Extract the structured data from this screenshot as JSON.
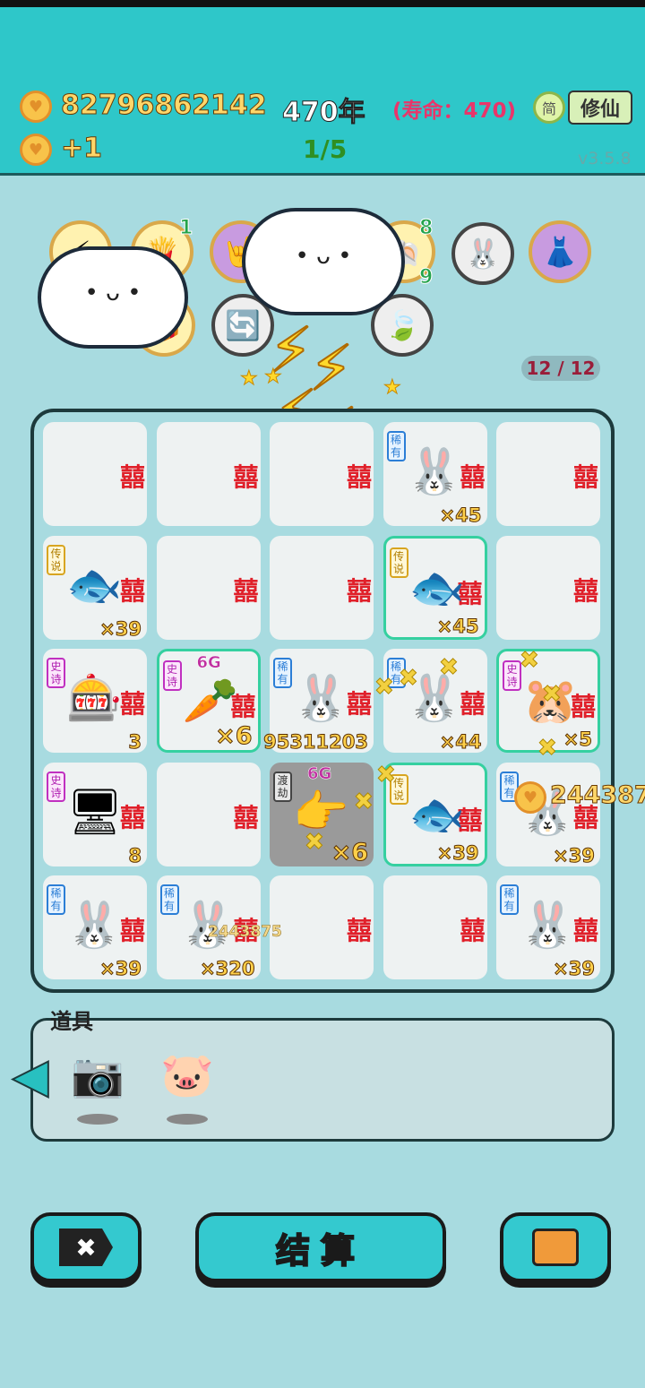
{
  "hud": {
    "coins": "82796862142",
    "income": "+1",
    "years": "470年",
    "lifespan": "(寿命：470)",
    "progress": "1/5",
    "lang_button": "简",
    "cultivate_button": "修仙",
    "version": "v3.5.8"
  },
  "relics": {
    "count_fries": "1",
    "count_shell": "8",
    "count_leaf": "9"
  },
  "board": {
    "counter": "12 / 12",
    "cells": [
      {
        "rarity": "",
        "icon": "empty",
        "mult": ""
      },
      {
        "rarity": "",
        "icon": "empty",
        "mult": ""
      },
      {
        "rarity": "",
        "icon": "empty",
        "mult": ""
      },
      {
        "rarity": "稀有",
        "icon": "rabbit",
        "mult": "×45"
      },
      {
        "rarity": "",
        "icon": "empty",
        "mult": ""
      },
      {
        "rarity": "传说",
        "icon": "koi-fish",
        "mult": "×39"
      },
      {
        "rarity": "",
        "icon": "empty",
        "mult": ""
      },
      {
        "rarity": "",
        "icon": "empty",
        "mult": ""
      },
      {
        "rarity": "传说",
        "icon": "koi-fish",
        "mult": "×45"
      },
      {
        "rarity": "",
        "icon": "empty",
        "mult": ""
      },
      {
        "rarity": "史诗",
        "icon": "gacha-machine",
        "mult": "3"
      },
      {
        "rarity": "史诗",
        "icon": "carrot",
        "mult": "×6",
        "tag": "6G"
      },
      {
        "rarity": "稀有",
        "icon": "rabbit",
        "mult": "95311203"
      },
      {
        "rarity": "稀有",
        "icon": "rabbit",
        "mult": "×44"
      },
      {
        "rarity": "史诗",
        "icon": "creature",
        "mult": "×5"
      },
      {
        "rarity": "史诗",
        "icon": "pc-case",
        "mult": "8"
      },
      {
        "rarity": "",
        "icon": "empty",
        "mult": ""
      },
      {
        "rarity": "渡劫",
        "icon": "pointing-hand",
        "mult": "×6",
        "tag": "6G"
      },
      {
        "rarity": "传说",
        "icon": "koi-fish",
        "mult": "×39"
      },
      {
        "rarity": "稀有",
        "icon": "rabbit",
        "mult": "×39"
      },
      {
        "rarity": "稀有",
        "icon": "rabbit",
        "mult": "×39"
      },
      {
        "rarity": "稀有",
        "icon": "rabbit",
        "mult": "×320"
      },
      {
        "rarity": "",
        "icon": "empty",
        "mult": ""
      },
      {
        "rarity": "",
        "icon": "empty",
        "mult": ""
      },
      {
        "rarity": "稀有",
        "icon": "rabbit",
        "mult": "×39"
      }
    ],
    "floating_coin_right": "244387",
    "floating_coin_small": "2443875",
    "xi_char": "囍"
  },
  "tools": {
    "label": "道具"
  },
  "buttons": {
    "settle": "结算",
    "close_glyph": "✖"
  }
}
